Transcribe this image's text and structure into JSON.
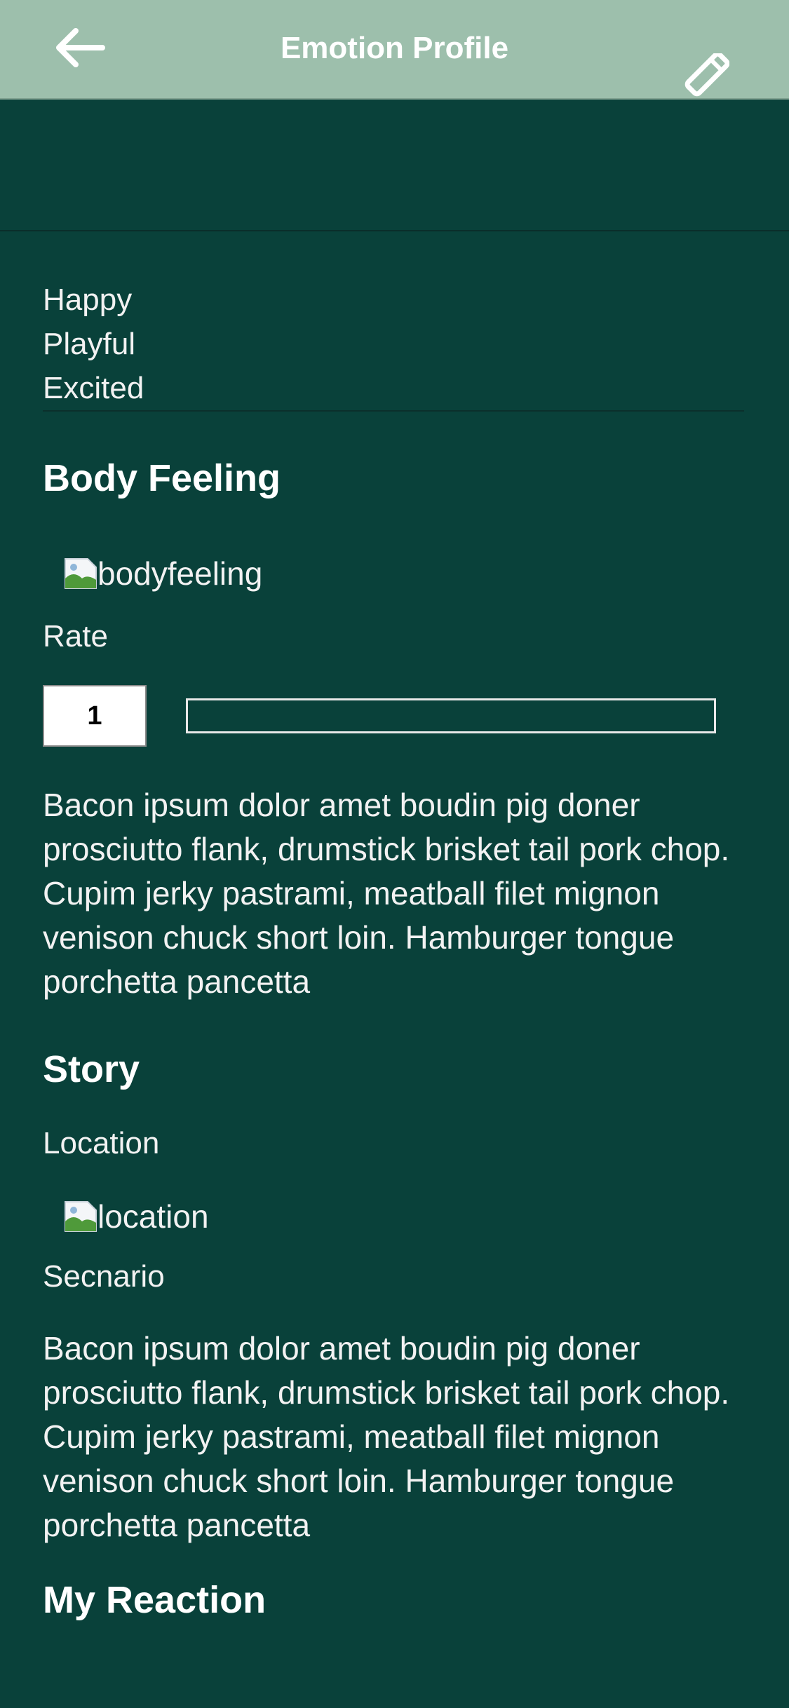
{
  "appbar": {
    "title": "Emotion Profile",
    "back_icon": "arrow-left-icon",
    "edit_icon": "pencil-icon",
    "background": "#9dbfac"
  },
  "emotions": [
    "Happy",
    "Playful",
    "Excited"
  ],
  "body_feeling": {
    "title": "Body Feeling",
    "image_alt": "bodyfeeling",
    "rate_label": "Rate",
    "rate_value": "1",
    "description": "Bacon ipsum dolor amet boudin pig doner prosciutto flank, drumstick brisket tail pork chop. Cupim jerky pastrami, meatball filet mignon venison chuck short loin. Hamburger tongue porchetta pancetta"
  },
  "story": {
    "title": "Story",
    "location_label": "Location",
    "location_image_alt": "location",
    "scenario_label": "Secnario",
    "scenario_text": "Bacon ipsum dolor amet boudin pig doner prosciutto flank, drumstick brisket tail pork chop. Cupim jerky pastrami, meatball filet mignon venison chuck short loin. Hamburger tongue porchetta pancetta"
  },
  "reaction": {
    "title": "My Reaction"
  },
  "colors": {
    "page_background": "#09413a",
    "text": "#f2f2f2"
  }
}
